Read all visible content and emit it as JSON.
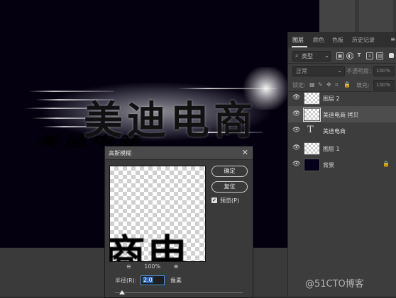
{
  "canvas": {
    "title_text": "美迪电商",
    "bg_color": "#04000f"
  },
  "layers_panel": {
    "tabs": [
      {
        "label": "图层",
        "active": true
      },
      {
        "label": "颜色",
        "active": false
      },
      {
        "label": "色板",
        "active": false
      },
      {
        "label": "历史记录",
        "active": false
      }
    ],
    "menu_icon": "hamburger-menu-icon",
    "filter_label": "类型",
    "filter_icons": [
      "image-filter-icon",
      "adjustment-filter-icon",
      "type-filter-icon",
      "shape-filter-icon",
      "smart-object-filter-icon"
    ],
    "blend_mode": "正常",
    "opacity_label": "不透明度:",
    "opacity_value": "100%",
    "lock_label": "锁定:",
    "fill_label": "填充:",
    "fill_value": "100%",
    "layers": [
      {
        "name": "图层 2",
        "type": "pixel",
        "selected": false
      },
      {
        "name": "美迪电商 拷贝",
        "type": "pixel",
        "selected": true
      },
      {
        "name": "美迪电商",
        "type": "text",
        "selected": false
      },
      {
        "name": "图层 1",
        "type": "pixel",
        "selected": false
      },
      {
        "name": "背景",
        "type": "background",
        "selected": false,
        "locked": true
      }
    ]
  },
  "dialog": {
    "title": "高斯模糊",
    "ok_label": "确定",
    "reset_label": "复位",
    "preview_label": "预览(P)",
    "preview_checked": true,
    "zoom_out_icon": "zoom-out-icon",
    "zoom_level": "100%",
    "zoom_in_icon": "zoom-in-icon",
    "radius_label": "半径(R):",
    "radius_value": "2.0",
    "radius_unit": "像素",
    "preview_glyphs": "商电"
  },
  "watermark": "@51CTO博客"
}
